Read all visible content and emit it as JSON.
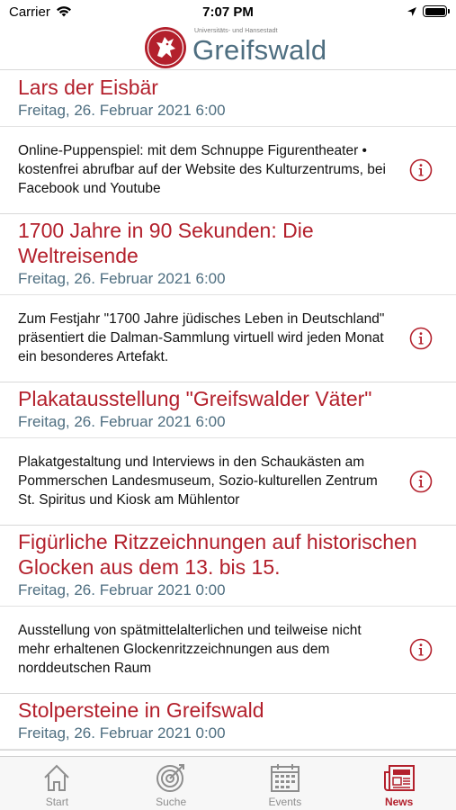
{
  "status": {
    "carrier": "Carrier",
    "time": "7:07 PM"
  },
  "header": {
    "logo_sub": "Universitäts- und Hansestadt",
    "logo_word": "Greifswald"
  },
  "news": [
    {
      "title": "Lars der Eisbär",
      "date": "Freitag, 26. Februar 2021 6:00",
      "desc": "Online-Puppenspiel: mit dem Schnuppe Figurentheater • kostenfrei abrufbar auf der Website des Kulturzentrums, bei Facebook und Youtube"
    },
    {
      "title": "1700 Jahre in 90 Sekunden: Die Weltreisende",
      "date": "Freitag, 26. Februar 2021 6:00",
      "desc": "Zum Festjahr \"1700 Jahre jüdisches Leben in Deutschland\" präsentiert die Dalman-Sammlung virtuell wird jeden Monat ein besonderes Artefakt."
    },
    {
      "title": "Plakatausstellung \"Greifswalder Väter\"",
      "date": "Freitag, 26. Februar 2021 6:00",
      "desc": "Plakatgestaltung und Interviews in den Schaukästen am Pommerschen Landesmuseum, Sozio-kulturellen Zentrum St. Spiritus und Kiosk am Mühlentor"
    },
    {
      "title": "Figürliche Ritzzeichnungen auf historischen Glocken aus dem 13. bis 15.",
      "date": "Freitag, 26. Februar 2021 0:00",
      "desc": "Ausstellung von spätmittelalterlichen und teilweise nicht mehr erhaltenen Glockenritzzeichnungen aus dem norddeutschen Raum"
    },
    {
      "title": "Stolpersteine in Greifswald",
      "date": "Freitag, 26. Februar 2021 0:00",
      "desc": ""
    }
  ],
  "tabs": [
    {
      "label": "Start",
      "icon": "house-icon",
      "active": false
    },
    {
      "label": "Suche",
      "icon": "search-target-icon",
      "active": false
    },
    {
      "label": "Events",
      "icon": "calendar-icon",
      "active": false
    },
    {
      "label": "News",
      "icon": "newspaper-icon",
      "active": true
    }
  ],
  "colors": {
    "accent": "#b3202c",
    "date": "#4e6e80",
    "inactive": "#8e8e8e"
  }
}
